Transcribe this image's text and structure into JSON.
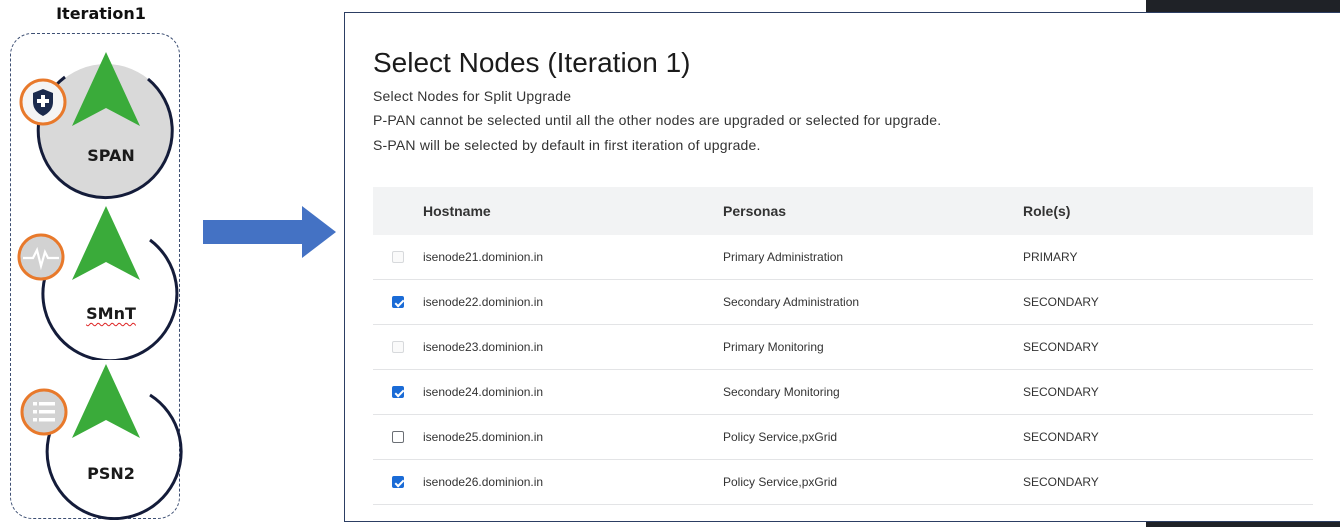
{
  "iteration": {
    "title": "Iteration1",
    "nodes": [
      {
        "label": "SPAN",
        "badge_icon": "shield-plus-icon"
      },
      {
        "label": "SMnT",
        "badge_icon": "heartbeat-icon"
      },
      {
        "label": "PSN2",
        "badge_icon": "list-icon"
      }
    ]
  },
  "panel": {
    "title": "Select Nodes (Iteration 1)",
    "subtitle": "Select Nodes for Split Upgrade",
    "note1": "P-PAN cannot be selected until all the other nodes are upgraded or selected for upgrade.",
    "note2": "S-PAN will be selected by default in first iteration of upgrade."
  },
  "table": {
    "headers": [
      "Hostname",
      "Personas",
      "Role(s)"
    ],
    "rows": [
      {
        "state": "disabled",
        "hostname": "isenode21.dominion.in",
        "personas": "Primary Administration",
        "role": "PRIMARY"
      },
      {
        "state": "checked",
        "hostname": "isenode22.dominion.in",
        "personas": "Secondary Administration",
        "role": "SECONDARY"
      },
      {
        "state": "disabled",
        "hostname": "isenode23.dominion.in",
        "personas": "Primary Monitoring",
        "role": "SECONDARY"
      },
      {
        "state": "checked",
        "hostname": "isenode24.dominion.in",
        "personas": "Secondary Monitoring",
        "role": "SECONDARY"
      },
      {
        "state": "unchecked",
        "hostname": "isenode25.dominion.in",
        "personas": "Policy Service,pxGrid",
        "role": "SECONDARY"
      },
      {
        "state": "checked",
        "hostname": "isenode26.dominion.in",
        "personas": "Policy Service,pxGrid",
        "role": "SECONDARY"
      }
    ]
  },
  "colors": {
    "accent_blue": "#4472c4",
    "node_green": "#3aab3a",
    "badge_orange": "#e8792b",
    "checkbox_blue": "#1a6bd6"
  }
}
